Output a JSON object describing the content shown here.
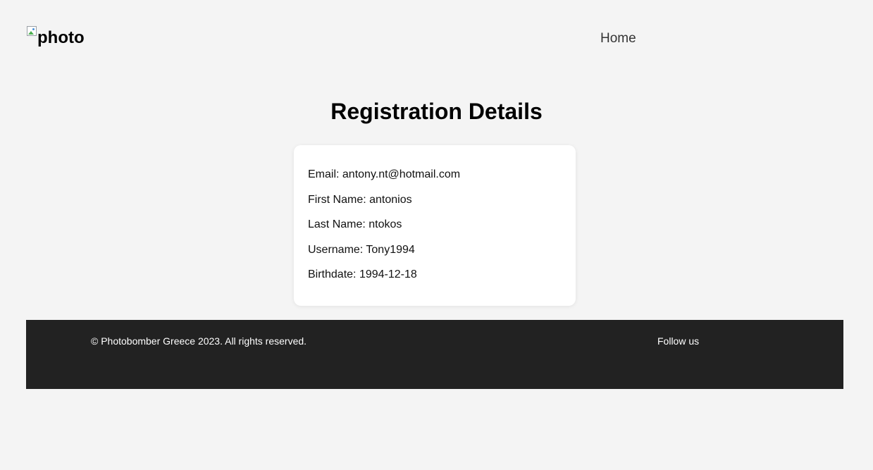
{
  "header": {
    "logo_alt": "photo",
    "logo_icon": "broken-image-icon",
    "nav": {
      "home": "Home"
    }
  },
  "main": {
    "title": "Registration Details",
    "details": [
      {
        "label": "Email:",
        "value": "antony.nt@hotmail.com"
      },
      {
        "label": "First Name:",
        "value": "antonios"
      },
      {
        "label": "Last Name:",
        "value": "ntokos"
      },
      {
        "label": "Username:",
        "value": "Tony1994"
      },
      {
        "label": "Birthdate:",
        "value": "1994-12-18"
      }
    ]
  },
  "footer": {
    "copyright": "© Photobomber Greece 2023. All rights reserved.",
    "follow": "Follow us"
  }
}
